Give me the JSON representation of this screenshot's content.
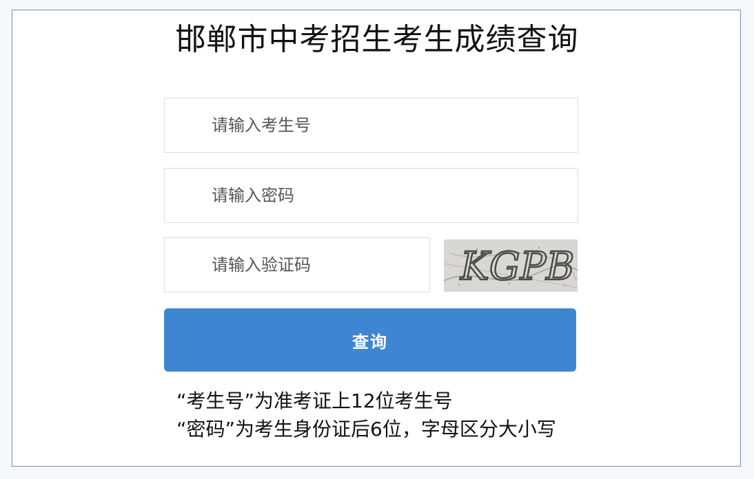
{
  "page": {
    "title": "邯郸市中考招生考生成绩查询"
  },
  "form": {
    "exam_number_placeholder": "请输入考生号",
    "password_placeholder": "请输入密码",
    "captcha_placeholder": "请输入验证码",
    "captcha_text": "KGPB",
    "submit_label": "查询"
  },
  "notes": {
    "line1": "“考生号”为准考证上12位考生号",
    "line2": "“密码”为考生身份证后6位，字母区分大小写"
  },
  "colors": {
    "button": "#3f86d2",
    "panel_border": "#6f8fb5"
  }
}
